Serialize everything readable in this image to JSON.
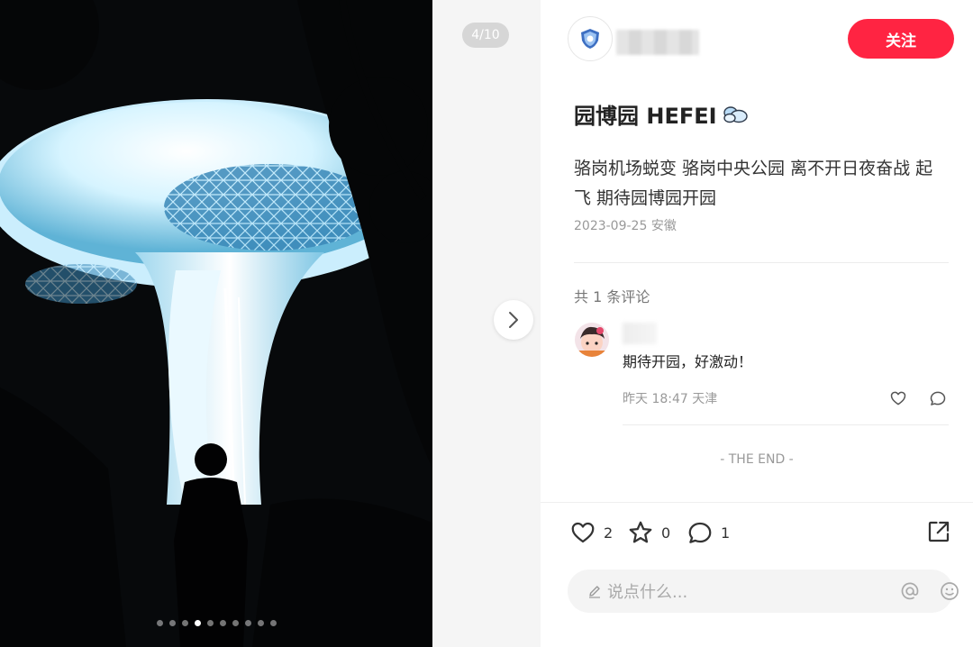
{
  "viewer": {
    "counter": "4/10",
    "dots_total": 10,
    "dots_active_index": 3
  },
  "author": {
    "follow_label": "关注"
  },
  "note": {
    "title": "园博园 HEFEI",
    "body": "骆岗机场蜕变 骆岗中央公园 离不开日夜奋战 起飞  期待园博园开园",
    "date": "2023-09-25",
    "location": "安徽"
  },
  "comments": {
    "count_label": "共 1 条评论",
    "items": [
      {
        "text": "期待开园，好激动！",
        "time": "昨天 18:47",
        "location": "天津"
      }
    ]
  },
  "end_label": "- THE END -",
  "actions": {
    "likes": "2",
    "favorites": "0",
    "comments": "1"
  },
  "input": {
    "placeholder": "说点什么..."
  },
  "colors": {
    "accent": "#ff2442"
  }
}
